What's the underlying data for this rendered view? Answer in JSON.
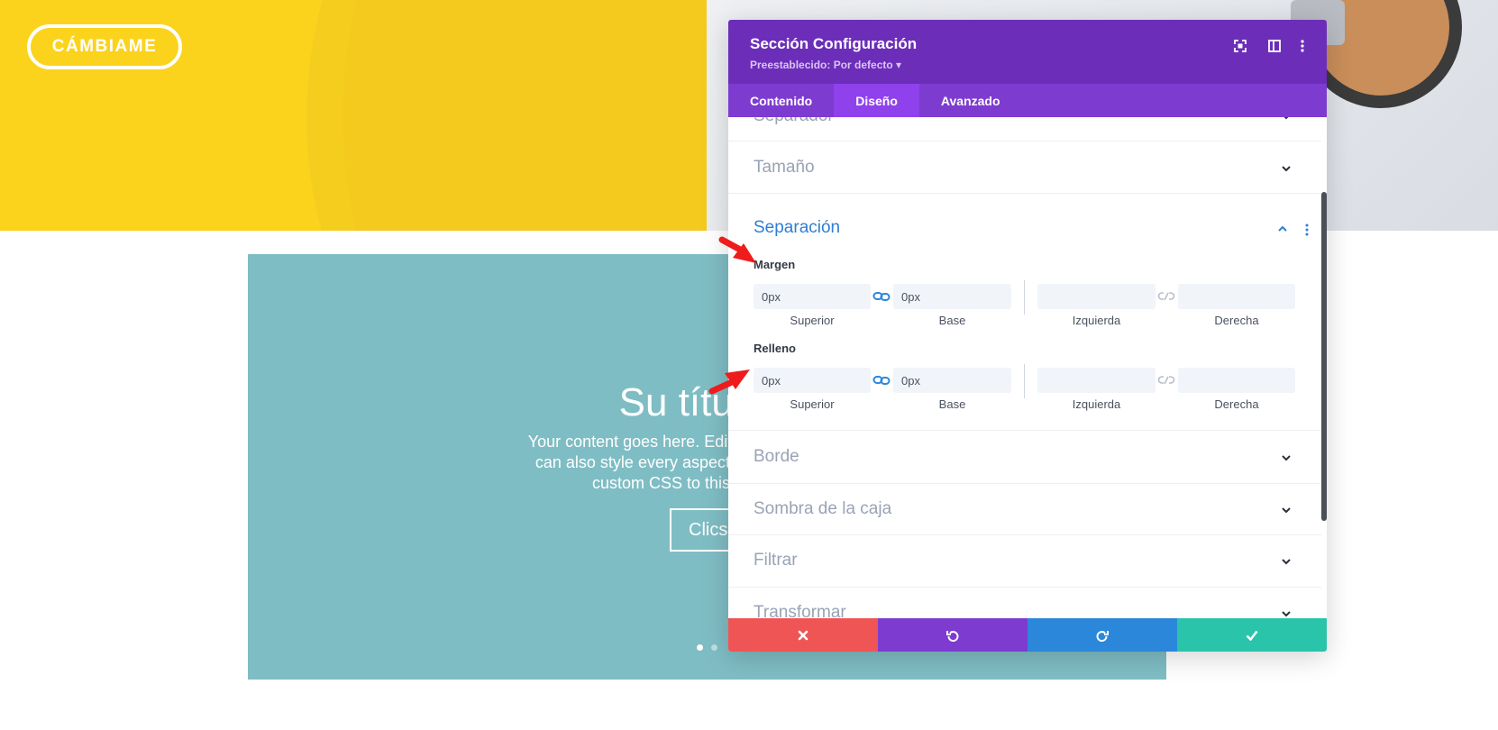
{
  "hero": {
    "button_label": "CÁMBIAME"
  },
  "slider": {
    "title": "Su título v",
    "text_lines": [
      "Your content goes here. Edit or remove this text in",
      "can also style every aspect of this content in the",
      "custom CSS to this text in the m"
    ],
    "button_label": "Clics"
  },
  "modal": {
    "title": "Sección Configuración",
    "preset": "Preestablecido: Por defecto ▾",
    "tabs": [
      "Contenido",
      "Diseño",
      "Avanzado"
    ],
    "active_tab": "Diseño",
    "sections": {
      "separador": "Separador",
      "tamano": "Tamaño",
      "separacion": "Separación",
      "borde": "Borde",
      "sombra": "Sombra de la caja",
      "filtrar": "Filtrar",
      "transformar": "Transformar"
    },
    "margen": {
      "label": "Margen",
      "top_value": "0px",
      "bottom_value": "0px",
      "left_value": "",
      "right_value": "",
      "sub_labels": [
        "Superior",
        "Base",
        "Izquierda",
        "Derecha"
      ]
    },
    "relleno": {
      "label": "Relleno",
      "top_value": "0px",
      "bottom_value": "0px",
      "left_value": "",
      "right_value": "",
      "sub_labels": [
        "Superior",
        "Base",
        "Izquierda",
        "Derecha"
      ]
    }
  },
  "colors": {
    "header_purple": "#6c2eb9",
    "tab_purple": "#7e3bd0",
    "active_tab": "#8f42ec",
    "cancel_red": "#ef5555",
    "redo_blue": "#2b87da",
    "save_green": "#29c4a9",
    "section_open_blue": "#2e7dd6",
    "hero_yellow": "#fbd31c",
    "slider_teal": "#7fbdc4"
  }
}
